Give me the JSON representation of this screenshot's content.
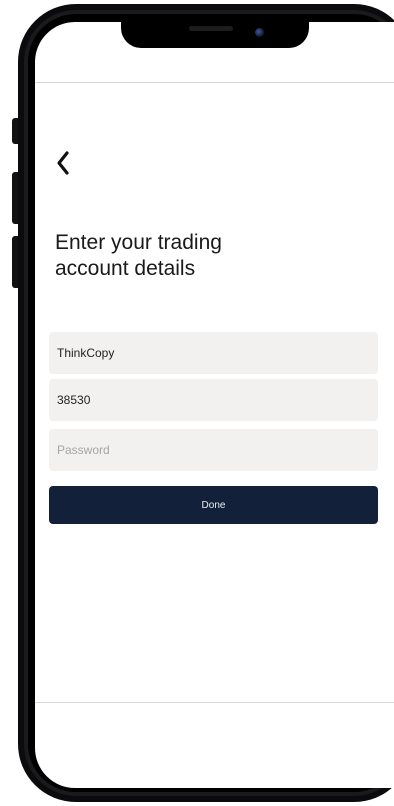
{
  "header": {
    "back_icon": "chevron-left-icon",
    "title_line1": "Enter your trading",
    "title_line2": "account details"
  },
  "form": {
    "server_value": "ThinkCopy",
    "account_value": "38530",
    "password_value": "",
    "password_placeholder": "Password",
    "done_label": "Done"
  },
  "colors": {
    "done_button_bg": "#13203a",
    "field_bg": "#f2f1f0"
  }
}
